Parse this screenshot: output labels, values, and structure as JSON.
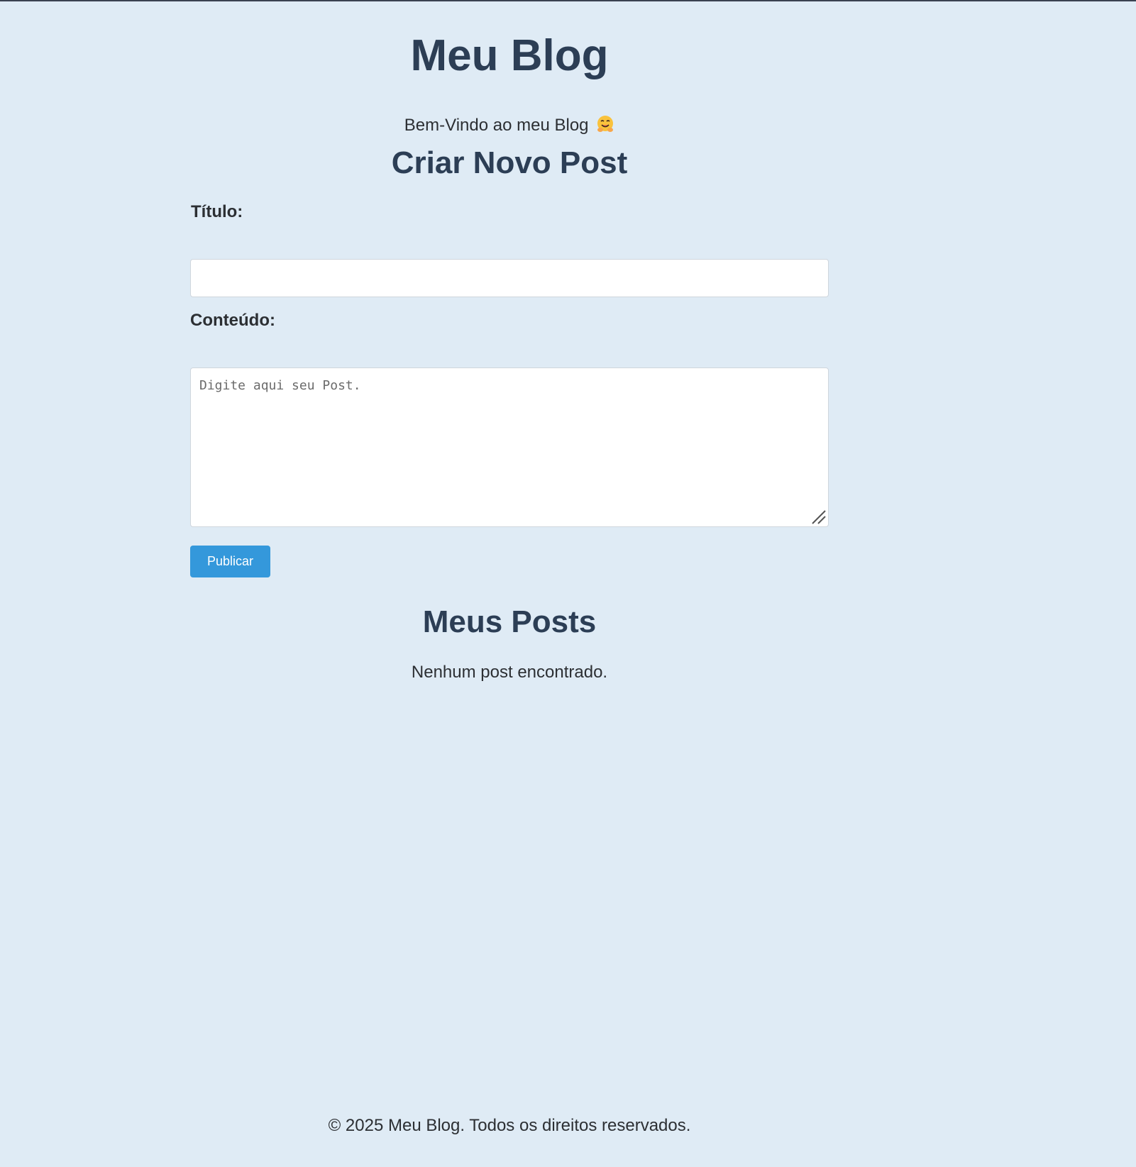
{
  "header": {
    "title": "Meu Blog",
    "welcome": "Bem-Vindo ao meu Blog"
  },
  "create_post": {
    "heading": "Criar Novo Post",
    "title_label": "Título:",
    "title_value": "",
    "content_label": "Conteúdo:",
    "content_placeholder": "Digite aqui seu Post.",
    "publish_label": "Publicar"
  },
  "posts": {
    "heading": "Meus Posts",
    "empty_message": "Nenhum post encontrado."
  },
  "footer": {
    "text": "© 2025 Meu Blog. Todos os direitos reservados."
  },
  "colors": {
    "background": "#dfebf5",
    "heading": "#2c3e55",
    "accent": "#3498db"
  },
  "icons": {
    "welcome_emoji": "hugging-face-icon",
    "textarea_grip": "resize-grip-icon"
  }
}
